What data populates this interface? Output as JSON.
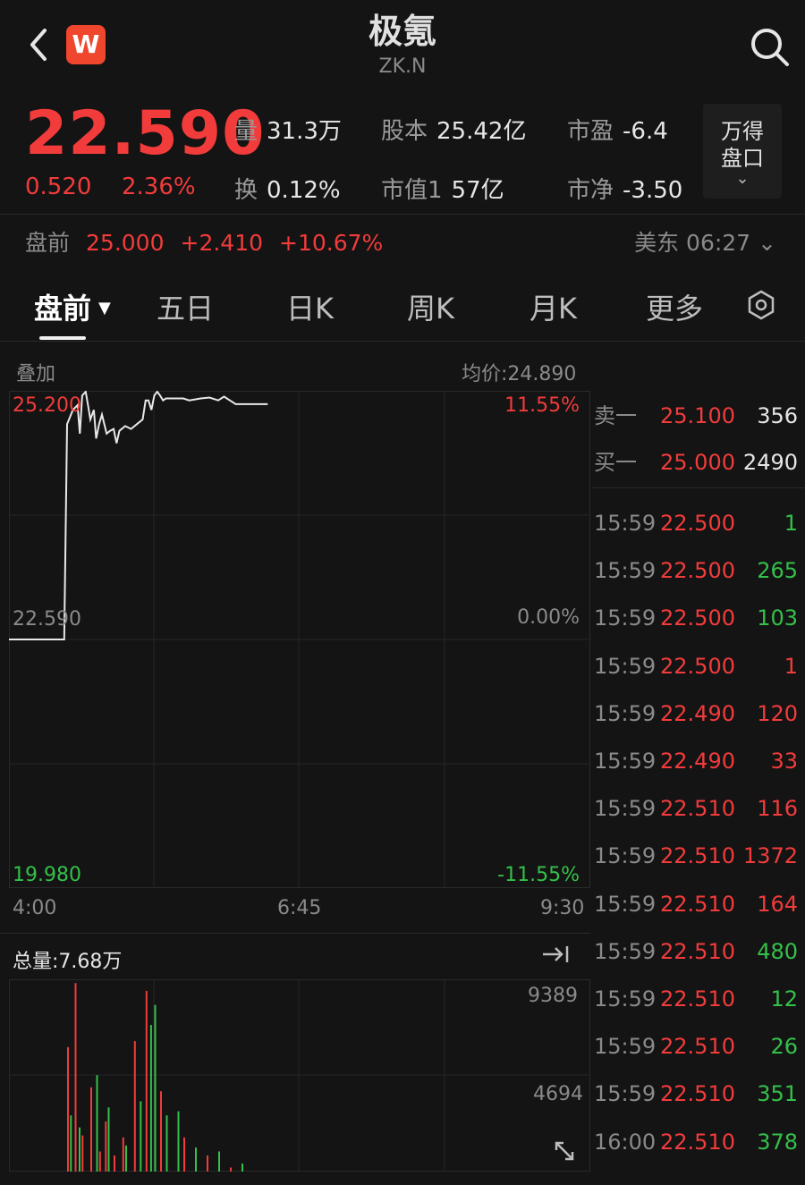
{
  "header": {
    "title": "极氪",
    "ticker": "ZK.N",
    "logo_letter": "W"
  },
  "quote": {
    "price": "22.590",
    "change": "0.520",
    "change_pct": "2.36%",
    "stats": [
      {
        "k": "量",
        "v": "31.3万"
      },
      {
        "k": "股本",
        "v": "25.42亿"
      },
      {
        "k": "市盈",
        "v": "-6.4"
      },
      {
        "k": "换",
        "v": "0.12%"
      },
      {
        "k": "市值1",
        "v": "57亿"
      },
      {
        "k": "市净",
        "v": "-3.50"
      }
    ],
    "wande_line1": "万得",
    "wande_line2": "盘口"
  },
  "premarket": {
    "label": "盘前",
    "price": "25.000",
    "change": "+2.410",
    "pct": "+10.67%",
    "time": "美东 06:27"
  },
  "tabs": [
    "盘前",
    "五日",
    "日K",
    "周K",
    "月K",
    "更多"
  ],
  "chart": {
    "overlay_label": "叠加",
    "avg_price": "均价:24.890",
    "y_top": "25.200",
    "y_mid": "22.590",
    "y_bot": "19.980",
    "pct_top": "11.55%",
    "pct_mid": "0.00%",
    "pct_bot": "-11.55%",
    "x_labels": [
      "4:00",
      "6:45",
      "9:30"
    ],
    "total_vol": "总量:7.68万",
    "vol_top": "9389",
    "vol_mid": "4694"
  },
  "book": {
    "asks": [
      {
        "label": "卖一",
        "price": "25.100",
        "vol": "356"
      }
    ],
    "bids": [
      {
        "label": "买一",
        "price": "25.000",
        "vol": "2490"
      }
    ]
  },
  "trades": [
    {
      "t": "15:59",
      "p": "22.500",
      "v": "1",
      "c": "green"
    },
    {
      "t": "15:59",
      "p": "22.500",
      "v": "265",
      "c": "green"
    },
    {
      "t": "15:59",
      "p": "22.500",
      "v": "103",
      "c": "green"
    },
    {
      "t": "15:59",
      "p": "22.500",
      "v": "1",
      "c": "red"
    },
    {
      "t": "15:59",
      "p": "22.490",
      "v": "120",
      "c": "red"
    },
    {
      "t": "15:59",
      "p": "22.490",
      "v": "33",
      "c": "red"
    },
    {
      "t": "15:59",
      "p": "22.510",
      "v": "116",
      "c": "red"
    },
    {
      "t": "15:59",
      "p": "22.510",
      "v": "1372",
      "c": "red"
    },
    {
      "t": "15:59",
      "p": "22.510",
      "v": "164",
      "c": "red"
    },
    {
      "t": "15:59",
      "p": "22.510",
      "v": "480",
      "c": "green"
    },
    {
      "t": "15:59",
      "p": "22.510",
      "v": "12",
      "c": "green"
    },
    {
      "t": "15:59",
      "p": "22.510",
      "v": "26",
      "c": "green"
    },
    {
      "t": "15:59",
      "p": "22.510",
      "v": "351",
      "c": "green"
    },
    {
      "t": "16:00",
      "p": "22.510",
      "v": "378",
      "c": "green"
    }
  ],
  "chart_data": {
    "type": "line",
    "y_range": [
      19.98,
      25.2
    ],
    "price_series": [
      [
        0,
        22.59
      ],
      [
        0.095,
        22.59
      ],
      [
        0.1,
        24.85
      ],
      [
        0.11,
        25.0
      ],
      [
        0.118,
        25.05
      ],
      [
        0.122,
        24.75
      ],
      [
        0.126,
        25.15
      ],
      [
        0.132,
        25.2
      ],
      [
        0.136,
        25.05
      ],
      [
        0.14,
        24.9
      ],
      [
        0.146,
        25.0
      ],
      [
        0.15,
        24.7
      ],
      [
        0.155,
        24.85
      ],
      [
        0.16,
        24.95
      ],
      [
        0.168,
        24.75
      ],
      [
        0.174,
        24.78
      ],
      [
        0.18,
        24.8
      ],
      [
        0.185,
        24.65
      ],
      [
        0.19,
        24.78
      ],
      [
        0.2,
        24.83
      ],
      [
        0.21,
        24.8
      ],
      [
        0.22,
        24.85
      ],
      [
        0.23,
        24.9
      ],
      [
        0.235,
        25.1
      ],
      [
        0.24,
        25.1
      ],
      [
        0.245,
        25.0
      ],
      [
        0.25,
        25.15
      ],
      [
        0.255,
        25.25
      ],
      [
        0.26,
        25.15
      ],
      [
        0.265,
        25.1
      ],
      [
        0.27,
        25.12
      ],
      [
        0.3,
        25.12
      ],
      [
        0.31,
        25.1
      ],
      [
        0.33,
        25.12
      ],
      [
        0.345,
        25.13
      ],
      [
        0.36,
        25.1
      ],
      [
        0.37,
        25.14
      ],
      [
        0.38,
        25.1
      ],
      [
        0.39,
        25.06
      ],
      [
        0.445,
        25.06
      ]
    ],
    "volume_series": {
      "red": [
        [
          0.1,
          6200
        ],
        [
          0.113,
          9389
        ],
        [
          0.125,
          1800
        ],
        [
          0.14,
          4200
        ],
        [
          0.155,
          1000
        ],
        [
          0.165,
          2500
        ],
        [
          0.18,
          800
        ],
        [
          0.195,
          1700
        ],
        [
          0.215,
          6500
        ],
        [
          0.235,
          9000
        ],
        [
          0.26,
          4000
        ],
        [
          0.3,
          1700
        ],
        [
          0.34,
          800
        ],
        [
          0.38,
          200
        ]
      ],
      "green": [
        [
          0.105,
          2800
        ],
        [
          0.12,
          2200
        ],
        [
          0.15,
          4800
        ],
        [
          0.17,
          3200
        ],
        [
          0.2,
          1300
        ],
        [
          0.225,
          3500
        ],
        [
          0.243,
          7300
        ],
        [
          0.25,
          8300
        ],
        [
          0.27,
          2800
        ],
        [
          0.29,
          3000
        ],
        [
          0.32,
          1200
        ],
        [
          0.36,
          1000
        ],
        [
          0.4,
          400
        ]
      ]
    }
  }
}
